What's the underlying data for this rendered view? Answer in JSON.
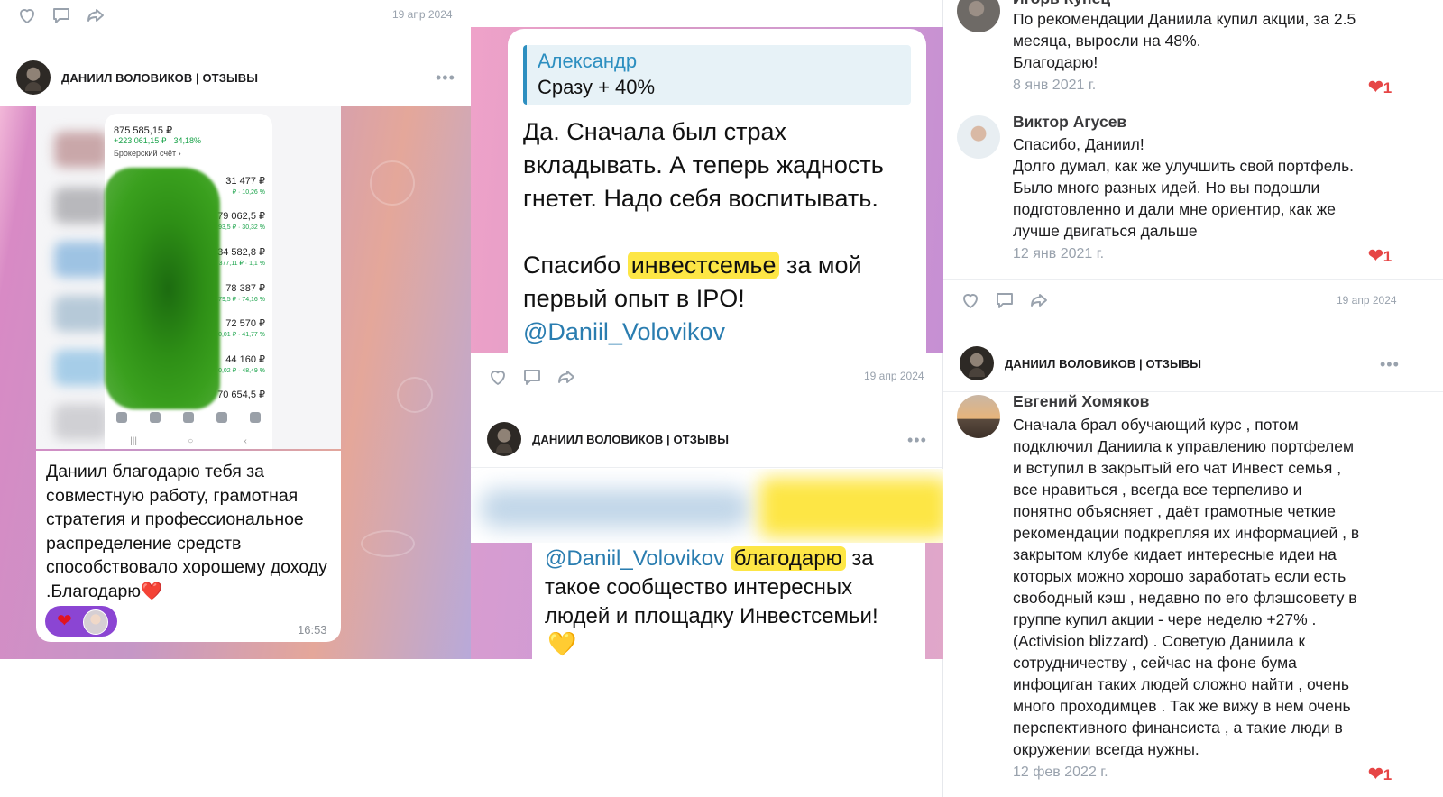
{
  "post1": {
    "date": "19 апр 2024"
  },
  "post2": {
    "channel": "ДАНИИЛ ВОЛОВИКОВ | ОТЗЫВЫ",
    "more": "•••",
    "screen": {
      "total": "875 585,15 ₽",
      "gain": "+223 061,15 ₽ · 34,18%",
      "broker": "Брокерский счёт ›",
      "rows": [
        {
          "value": "31 477 ₽",
          "sub": "₽ · 10,26 %"
        },
        {
          "value": "79 062,5 ₽",
          "sub": "93,5 ₽ · 30,32 %"
        },
        {
          "value": "34 582,8 ₽",
          "sub": "377,11 ₽ · 1,1 %"
        },
        {
          "value": "78 387 ₽",
          "sub": "79,5 ₽ · 74,16 %"
        },
        {
          "value": "72 570 ₽",
          "sub": "0,01 ₽ · 41,77 %"
        },
        {
          "value": "44 160 ₽",
          "sub": "0,02 ₽ · 48,49 %"
        },
        {
          "value": "70 654,5 ₽",
          "sub": ""
        }
      ]
    },
    "message": "Даниил благодарю тебя за совместную работу, грамотная стратегия  и  профессиональное распределение  средств способствовало  хорошему доходу .Благодарю❤️",
    "reaction_heart": "❤",
    "time": "16:53"
  },
  "post3": {
    "quote_name": "Александр",
    "quote_text": "Сразу + 40%",
    "message_part1": "Да. Сначала был страх вкладывать. А теперь жадность гнетет. Надо себя воспитывать.",
    "thanks_before": "Спасибо ",
    "thanks_highlight": "инвестсемье",
    "thanks_after": " за мой первый опыт в IPO!",
    "mention": "@Daniil_Volovikov",
    "date": "19 апр 2024"
  },
  "post4": {
    "channel": "ДАНИИЛ ВОЛОВИКОВ | ОТЗЫВЫ",
    "more": "•••",
    "mention": "@Daniil_Volovikov",
    "highlight": "благодарю",
    "message_after": " за такое сообщество интересных людей и площадку Инвестсемьи!",
    "gold_heart": "💛"
  },
  "comments": [
    {
      "name": "Игорь Купец",
      "lines": [
        "По рекомендации Даниила купил акции, за 2.5",
        "месяца, выросли на 48%.",
        "Благодарю!"
      ],
      "date": "8 янв 2021 г.",
      "likes": "1"
    },
    {
      "name": "Виктор Агусев",
      "lines": [
        "Спасибо, Даниил!",
        "Долго думал, как же улучшить свой портфель.",
        "Было много разных идей. Но вы подошли",
        "подготовленно и дали мне ориентир, как же",
        "лучше двигаться дальше"
      ],
      "date": "12 янв 2021 г.",
      "likes": "1"
    },
    {
      "name": "Евгений Хомяков",
      "lines": [
        "Сначала брал обучающий курс , потом",
        "подключил Даниила к управлению портфелем",
        "и вступил в закрытый его чат Инвест семья ,",
        "все нравиться , всегда все терпеливо и",
        "понятно объясняет , даёт грамотные четкие",
        "рекомендации подкрепляя их информацией , в",
        "закрытом клубе кидает интересные идеи на",
        "которых можно хорошо заработать если есть",
        "свободный кэш , недавно по его флэшсовету в",
        "группе купил акции - чере неделю +27% .",
        "(Activision blizzard) . Советую Даниила к",
        "сотрудничеству , сейчас на фоне бума",
        "инфоциган таких людей сложно найти , очень",
        "много проходимцев . Так же вижу в нем очень",
        "перспективного финансиста , а такие люди в",
        "окружении всегда нужны."
      ],
      "date": "12 фев 2022 г.",
      "likes": "1"
    }
  ],
  "post5": {
    "date": "19 апр 2024",
    "channel": "ДАНИИЛ ВОЛОВИКОВ | ОТЗЫВЫ",
    "more": "•••"
  },
  "icons": {
    "like": "heart-outline-icon",
    "comment": "comment-icon",
    "share": "share-icon"
  },
  "colors": {
    "accent_blue": "#2d8fc0",
    "highlight_yellow": "#fde645",
    "like_red": "#e64646",
    "muted_gray": "#99a2ad"
  }
}
